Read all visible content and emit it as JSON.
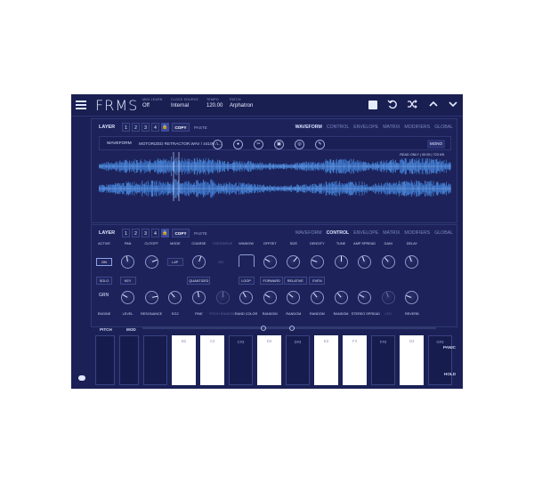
{
  "header": {
    "app_title": "FRMS",
    "midi_learn": {
      "label": "MIDI LEARN",
      "value": "Off"
    },
    "clock_source": {
      "label": "CLOCK SOURCE",
      "value": "Internal"
    },
    "tempo": {
      "label": "TEMPO",
      "value": "120.00"
    },
    "patch": {
      "label": "PATCH",
      "value": "Arphatron"
    },
    "icons": [
      "menu-icon",
      "stop-icon",
      "undo-icon",
      "shuffle-icon",
      "chevron-up-icon",
      "chevron-down-icon"
    ]
  },
  "layer_top": {
    "label": "LAYER",
    "numbers": [
      "1",
      "2",
      "3",
      "4"
    ],
    "copy": "COPY",
    "paste": "PASTE",
    "tabs": [
      "WAVEFORM",
      "CONTROL",
      "ENVELOPE",
      "MATRIX",
      "MODIFIERS",
      "GLOBAL"
    ],
    "active_tab": "WAVEFORM"
  },
  "waveform": {
    "label": "WAVEFORM",
    "file": "MOTORIZED RETRACTOR.WAV / 44100 / ...",
    "mono": "MONO",
    "readonly": "READ ONLY | 00:05 | 723 KB",
    "buttons": [
      "download-icon",
      "record-icon",
      "scissors-icon",
      "trash-icon",
      "globe-icon",
      "edit-icon"
    ]
  },
  "layer_bottom": {
    "label": "LAYER",
    "numbers": [
      "1",
      "2",
      "3",
      "4"
    ],
    "copy": "COPY",
    "paste": "PASTE",
    "tabs": [
      "WAVEFORM",
      "CONTROL",
      "ENVELOPE",
      "MATRIX",
      "MODIFIERS",
      "GLOBAL"
    ],
    "active_tab": "CONTROL"
  },
  "controls": {
    "row1_labels": [
      "ACTIVE",
      "PAN",
      "CUTOFF",
      "MODE",
      "COARSE",
      "OVERDRIVE",
      "WINDOW",
      "OFFSET",
      "SIZE",
      "DENSITY",
      "TUNE",
      "AMP SPREAD",
      "GAIN",
      "DELAY"
    ],
    "active_btn": "ON",
    "mode_btn": "L4P",
    "on_small": "ON",
    "solo": "SOLO",
    "key": "KEY",
    "quantized": "QUANTIZED",
    "loop": "LOOP",
    "forward": "FORWARD",
    "relative": "RELATIVE",
    "even": "EVEN",
    "engine_value": "GRN",
    "row2_labels": [
      "ENGINE",
      "LEVEL",
      "RESONANCE",
      "EG2",
      "FINE",
      "PITCH RANDOM",
      "RAND COLOR",
      "RANDOM",
      "RANDOM",
      "RANDOM",
      "RANDOM",
      "STEREO SPREAD",
      "LFO",
      "REVERB"
    ]
  },
  "keyboard": {
    "pitch_label": "PITCH",
    "mod_label": "MOD",
    "keys": [
      "",
      "B2",
      "C3",
      "C#3",
      "D3",
      "D#3",
      "E3",
      "F3",
      "F#3",
      "G3",
      "G#3"
    ],
    "panic": "PANIC",
    "hold": "HOLD"
  },
  "colors": {
    "background": "#1b2156",
    "accent": "#4a86d8",
    "text": "#c8d2ee"
  }
}
